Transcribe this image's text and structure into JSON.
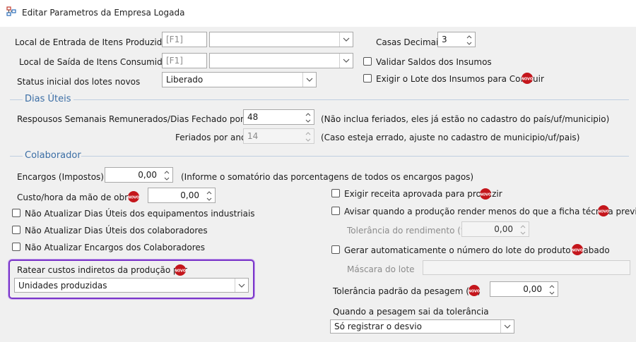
{
  "window": {
    "title": "Editar Parametros da Empresa Logada"
  },
  "top": {
    "local_entrada_label": "Local de Entrada de Itens Produzidos",
    "local_entrada_code": "[F1]",
    "local_saida_label": "Local de Saída de Itens Consumidos",
    "local_saida_code": "[F1]",
    "status_label": "Status inicial dos lotes novos",
    "status_value": "Liberado",
    "casas_label": "Casas Decimais",
    "casas_value": "3",
    "validar_label": "Validar Saldos dos Insumos",
    "exigir_lote_label": "Exigir o Lote dos Insumos para Concluir",
    "novo_badge": "NOVO"
  },
  "dias_uteis": {
    "section": "Dias Úteis",
    "repousos_label": "Respousos Semanais Remunerados/Dias Fechado por ano",
    "repousos_value": "48",
    "repousos_hint": "(Não inclua feriados, eles já estão no cadastro do país/uf/municipio)",
    "feriados_label": "Feriados por ano",
    "feriados_value": "14",
    "feriados_hint": "(Caso esteja errado, ajuste no cadastro de municipio/uf/pais)"
  },
  "colaborador": {
    "section": "Colaborador",
    "encargos_label": "Encargos (Impostos)",
    "encargos_value": "0,00",
    "encargos_hint": "(Informe o somatório das porcentagens de todos os encargos pagos)",
    "custo_label": "Custo/hora da mão de obra:",
    "custo_value": "0,00",
    "nao_eq_label": "Não Atualizar Dias Úteis dos equipamentos industriais",
    "nao_col_label": "Não Atualizar Dias Úteis dos colaboradores",
    "nao_enc_label": "Não Atualizar Encargos dos Colaboradores",
    "ratear_label": "Ratear custos indiretos da produção por",
    "ratear_value": "Unidades produzidas"
  },
  "producao": {
    "exigir_receita_label": "Exigir receita aprovada para produzir",
    "avisar_label": "Avisar quando a produção render menos do que a ficha técnica previa",
    "tolerancia_rend_label": "Tolerância do rendimento (%)",
    "tolerancia_rend_value": "0,00",
    "gerar_label": "Gerar automaticamente o número do lote do produto acabado",
    "mascara_label": "Máscara do lote",
    "mascara_value": "",
    "tol_pesagem_label": "Tolerância padrão da pesagem (%)",
    "tol_pesagem_value": "0,00",
    "quando_label": "Quando a pesagem sai da tolerância",
    "quando_value": "Só registrar o desvio"
  },
  "colors": {
    "accent": "#3b6ea5",
    "highlight": "#7a35c9",
    "badge": "#c4161c"
  }
}
